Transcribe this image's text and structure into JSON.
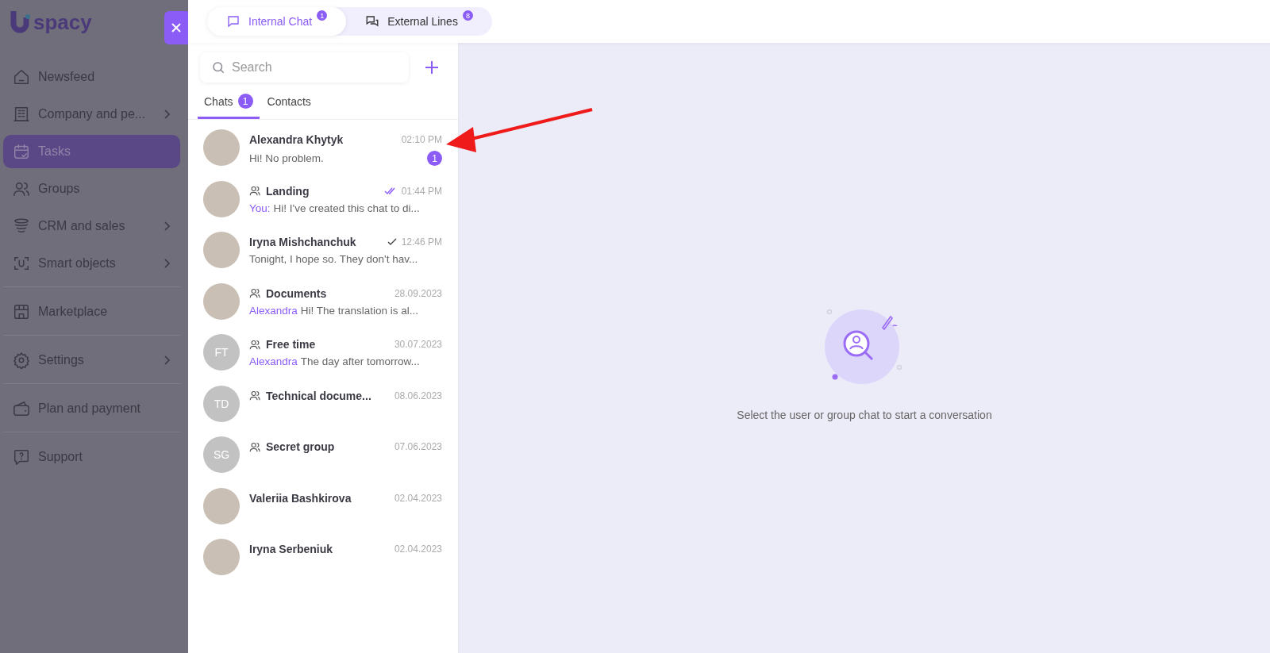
{
  "logo": {
    "text": "spacy"
  },
  "sidebar": {
    "sections": [
      [
        {
          "label": "Newsfeed",
          "kind": "home",
          "chevron": false,
          "selected": false
        },
        {
          "label": "Company and pe...",
          "kind": "building",
          "chevron": true,
          "selected": false
        },
        {
          "label": "Tasks",
          "kind": "calendar",
          "chevron": false,
          "selected": true
        },
        {
          "label": "Groups",
          "kind": "people",
          "chevron": false,
          "selected": false
        },
        {
          "label": "CRM and sales",
          "kind": "funnel",
          "chevron": true,
          "selected": false
        },
        {
          "label": "Smart objects",
          "kind": "scan",
          "chevron": true,
          "selected": false
        }
      ],
      [
        {
          "label": "Marketplace",
          "kind": "store",
          "chevron": false,
          "selected": false
        }
      ],
      [
        {
          "label": "Settings",
          "kind": "gear",
          "chevron": true,
          "selected": false
        }
      ],
      [
        {
          "label": "Plan and payment",
          "kind": "wallet",
          "chevron": false,
          "selected": false
        }
      ],
      [
        {
          "label": "Support",
          "kind": "help",
          "chevron": false,
          "selected": false
        }
      ]
    ]
  },
  "top_tabs": [
    {
      "label": "Internal Chat",
      "badge": "1",
      "kind": "chat",
      "selected": true
    },
    {
      "label": "External Lines",
      "badge": "8",
      "kind": "chats",
      "selected": false
    }
  ],
  "search": {
    "placeholder": "Search"
  },
  "list_tabs": [
    {
      "label": "Chats",
      "badge": "1",
      "selected": true
    },
    {
      "label": "Contacts",
      "selected": false
    }
  ],
  "chats": [
    {
      "name": "Alexandra Khytyk",
      "group": false,
      "kind": "photo",
      "time": "02:10 PM",
      "preview": "Hi! No problem.",
      "unread": "1"
    },
    {
      "name": "Landing",
      "group": true,
      "kind": "photo",
      "time": "01:44 PM",
      "read": true,
      "author": "You:",
      "preview": "Hi! I've created this chat to di..."
    },
    {
      "name": "Iryna Mishchanchuk",
      "group": false,
      "kind": "photo",
      "time": "12:46 PM",
      "read": false,
      "preview": "Tonight, I hope so. They don't hav..."
    },
    {
      "name": "Documents",
      "group": true,
      "kind": "photo",
      "time": "28.09.2023",
      "author": "Alexandra",
      "preview": "Hi! The translation is al..."
    },
    {
      "name": "Free time",
      "group": true,
      "kind": "initials",
      "initials": "FT",
      "time": "30.07.2023",
      "author": "Alexandra",
      "preview": "The day after tomorrow..."
    },
    {
      "name": "Technical docume...",
      "group": true,
      "kind": "initials",
      "initials": "TD",
      "time": "08.06.2023"
    },
    {
      "name": "Secret group",
      "group": true,
      "kind": "initials",
      "initials": "SG",
      "time": "07.06.2023"
    },
    {
      "name": "Valeriia Bashkirova",
      "group": false,
      "kind": "photo",
      "time": "02.04.2023"
    },
    {
      "name": "Iryna Serbeniuk",
      "group": false,
      "kind": "photo",
      "time": "02.04.2023"
    }
  ],
  "empty_state": {
    "text": "Select the user or group chat to start a conversation"
  }
}
